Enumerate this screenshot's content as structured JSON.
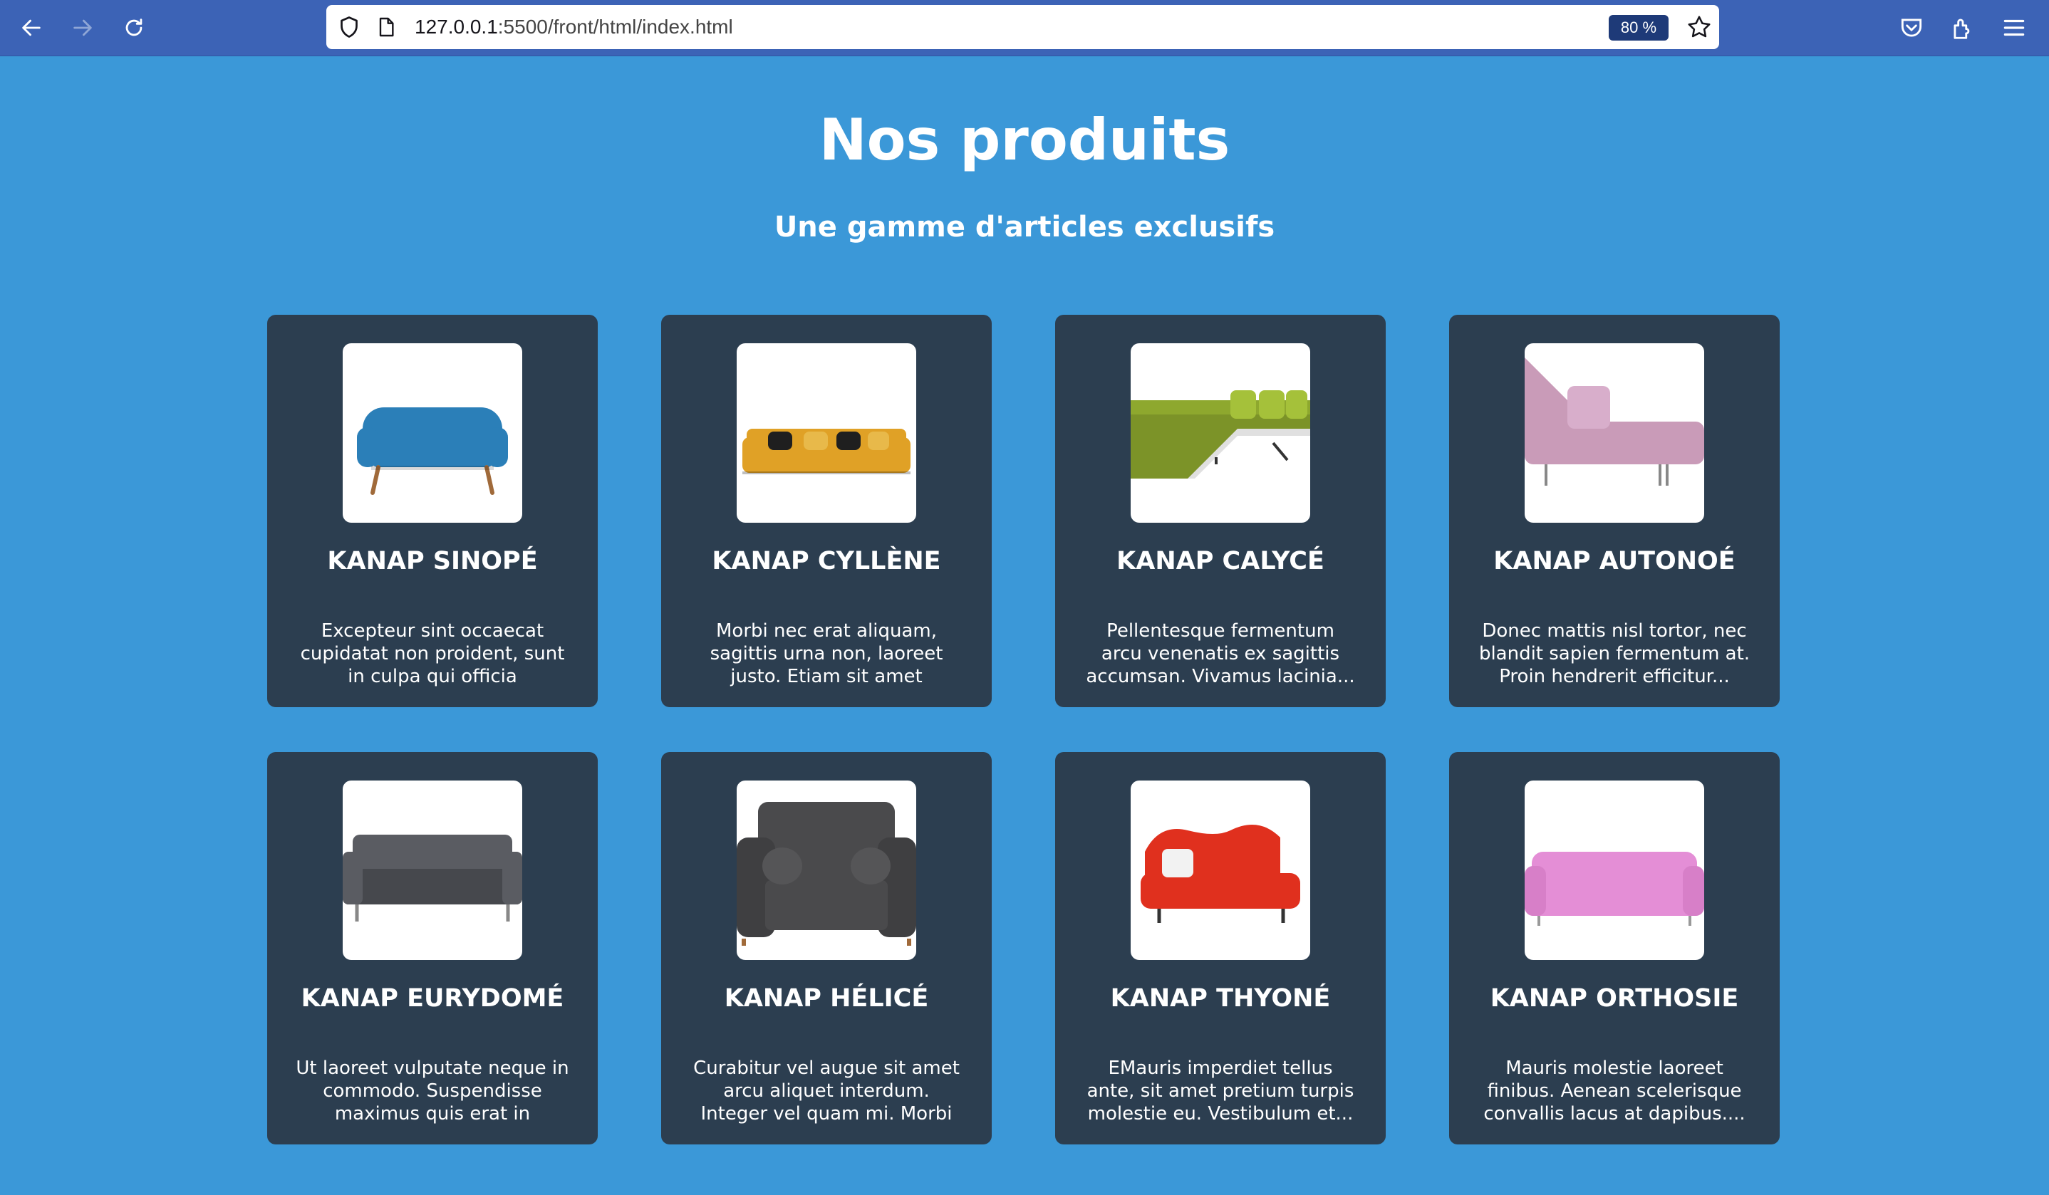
{
  "browser": {
    "url_host": "127.0.0.1",
    "url_path": ":5500/front/html/index.html",
    "zoom": "80 %"
  },
  "header": {
    "title": "Nos produits",
    "subtitle": "Une gamme d'articles exclusifs"
  },
  "products": [
    {
      "name": "KANAP SINOPÉ",
      "description": "Excepteur sint occaecat cupidatat non proident, sunt in culpa qui officia deserunt...",
      "color": "#2b7fb8"
    },
    {
      "name": "KANAP CYLLÈNE",
      "description": "Morbi nec erat aliquam, sagittis urna non, laoreet justo. Etiam sit amet interdum dia...",
      "color": "#e0a126"
    },
    {
      "name": "KANAP CALYCÉ",
      "description": "Pellentesque fermentum arcu venenatis ex sagittis accumsan. Vivamus lacinia...",
      "color": "#8ea82e"
    },
    {
      "name": "KANAP AUTONOÉ",
      "description": "Donec mattis nisl tortor, nec blandit sapien fermentum at. Proin hendrerit efficitur...",
      "color": "#c99bb8"
    },
    {
      "name": "KANAP EURYDOMÉ",
      "description": "Ut laoreet vulputate neque in commodo. Suspendisse maximus quis erat in sagittis...",
      "color": "#5a5c62"
    },
    {
      "name": "KANAP HÉLICÉ",
      "description": "Curabitur vel augue sit amet arcu aliquet interdum. Integer vel quam mi. Morbi nec...",
      "color": "#4a4a4c"
    },
    {
      "name": "KANAP THYONÉ",
      "description": "EMauris imperdiet tellus ante, sit amet pretium turpis molestie eu. Vestibulum et...",
      "color": "#e0301e"
    },
    {
      "name": "KANAP ORTHOSIE",
      "description": "Mauris molestie laoreet finibus. Aenean scelerisque convallis lacus at dapibus....",
      "color": "#e48ed6"
    }
  ]
}
